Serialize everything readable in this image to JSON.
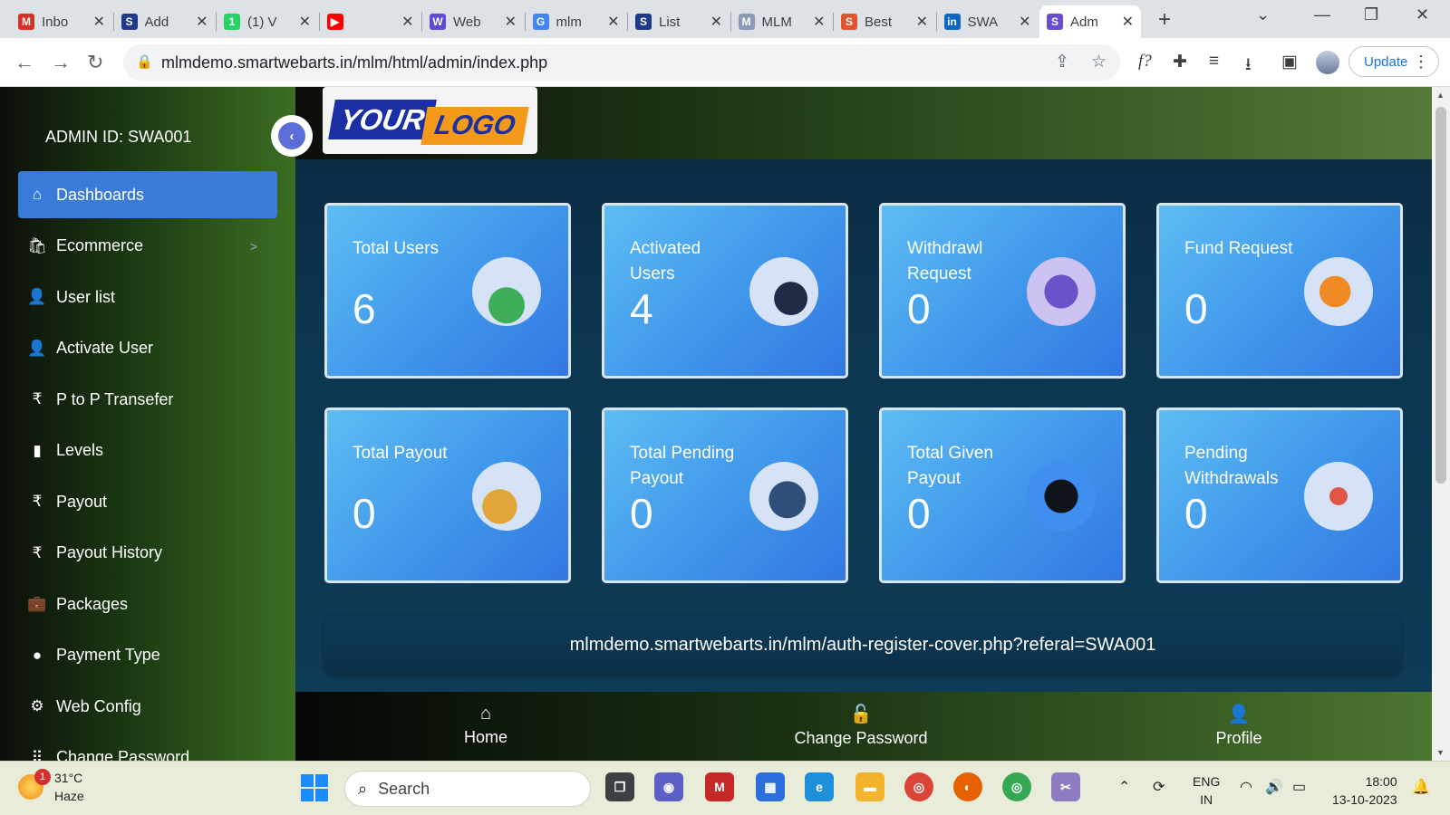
{
  "browser": {
    "tabs": [
      {
        "title": "Inbo",
        "icon": "gmail-icon",
        "color": "#d93025",
        "glyph": "M"
      },
      {
        "title": "Add",
        "icon": "s-site-icon",
        "color": "#1f3a8a",
        "glyph": "S"
      },
      {
        "title": "(1) V",
        "icon": "whatsapp-icon",
        "color": "#25d366",
        "glyph": "1"
      },
      {
        "title": "",
        "icon": "youtube-icon",
        "color": "#ff0000",
        "glyph": "▶"
      },
      {
        "title": "Web",
        "icon": "web-icon",
        "color": "#5b4bd6",
        "glyph": "W"
      },
      {
        "title": "mlm",
        "icon": "google-icon",
        "color": "#4285f4",
        "glyph": "G"
      },
      {
        "title": "List",
        "icon": "s-site-icon",
        "color": "#1f3a8a",
        "glyph": "S"
      },
      {
        "title": "MLM",
        "icon": "mlm-icon",
        "color": "#8a9bb5",
        "glyph": "M"
      },
      {
        "title": "Best",
        "icon": "swa-icon",
        "color": "#e0552b",
        "glyph": "S"
      },
      {
        "title": "SWA",
        "icon": "linkedin-icon",
        "color": "#0a66c2",
        "glyph": "in"
      },
      {
        "title": "Adm",
        "icon": "admin-icon",
        "color": "#6a4bd6",
        "glyph": "S",
        "active": true
      }
    ],
    "url": "mlmdemo.smartwebarts.in/mlm/html/admin/index.php",
    "update_label": "Update"
  },
  "sidebar": {
    "admin_id": "ADMIN ID: SWA001",
    "items": [
      {
        "label": "Dashboards",
        "icon": "home-icon",
        "glyph": "⌂",
        "active": true
      },
      {
        "label": "Ecommerce",
        "icon": "bag-icon",
        "glyph": "🛍",
        "chevron": ">"
      },
      {
        "label": "User list",
        "icon": "user-icon",
        "glyph": "👤"
      },
      {
        "label": "Activate User",
        "icon": "user-icon",
        "glyph": "👤"
      },
      {
        "label": "P to P Transefer",
        "icon": "rupee-icon",
        "glyph": "₹"
      },
      {
        "label": "Levels",
        "icon": "bar-chart-icon",
        "glyph": "▮"
      },
      {
        "label": "Payout",
        "icon": "rupee-icon",
        "glyph": "₹"
      },
      {
        "label": "Payout History",
        "icon": "rupee-icon",
        "glyph": "₹"
      },
      {
        "label": "Packages",
        "icon": "briefcase-icon",
        "glyph": "💼"
      },
      {
        "label": "Payment Type",
        "icon": "payment-icon",
        "glyph": "●"
      },
      {
        "label": "Web Config",
        "icon": "gear-icon",
        "glyph": "⚙"
      },
      {
        "label": "Change Password",
        "icon": "grid-icon",
        "glyph": "⠿"
      }
    ]
  },
  "logo": {
    "part1": "YOUR",
    "part2": "LOGO"
  },
  "cards": [
    {
      "title": "Total Users",
      "value": "6",
      "icon": "users-group-icon"
    },
    {
      "title": "Activated Users",
      "value": "4",
      "icon": "user-computer-icon"
    },
    {
      "title": "Withdrawl Request",
      "value": "0",
      "icon": "wallet-icon"
    },
    {
      "title": "Fund Request",
      "value": "0",
      "icon": "phone-transfer-icon"
    },
    {
      "title": "Total Payout",
      "value": "0",
      "icon": "coins-icon"
    },
    {
      "title": "Total Pending Payout",
      "value": "0",
      "icon": "clock-payment-icon"
    },
    {
      "title": "Total Given Payout",
      "value": "0",
      "icon": "mobile-dollar-icon"
    },
    {
      "title": "Pending Withdrawals",
      "value": "0",
      "icon": "withdrawals-icon"
    }
  ],
  "referral_link": "mlmdemo.smartwebarts.in/mlm/auth-register-cover.php?referal=SWA001",
  "bottom_nav": [
    {
      "label": "Home",
      "icon": "home-icon",
      "glyph": "⌂"
    },
    {
      "label": "Change Password",
      "icon": "lock-icon",
      "glyph": "🔓"
    },
    {
      "label": "Profile",
      "icon": "person-icon",
      "glyph": "👤"
    }
  ],
  "taskbar": {
    "weather_temp": "31°C",
    "weather_desc": "Haze",
    "weather_badge": "1",
    "search_placeholder": "Search",
    "lang_top": "ENG",
    "lang_bottom": "IN",
    "time": "18:00",
    "date": "13-10-2023"
  },
  "colors": {
    "accent": "#3a7ad9",
    "card_gradient_start": "#5ebcf3",
    "card_gradient_end": "#3377e2",
    "main_bg": "#0d3650"
  }
}
